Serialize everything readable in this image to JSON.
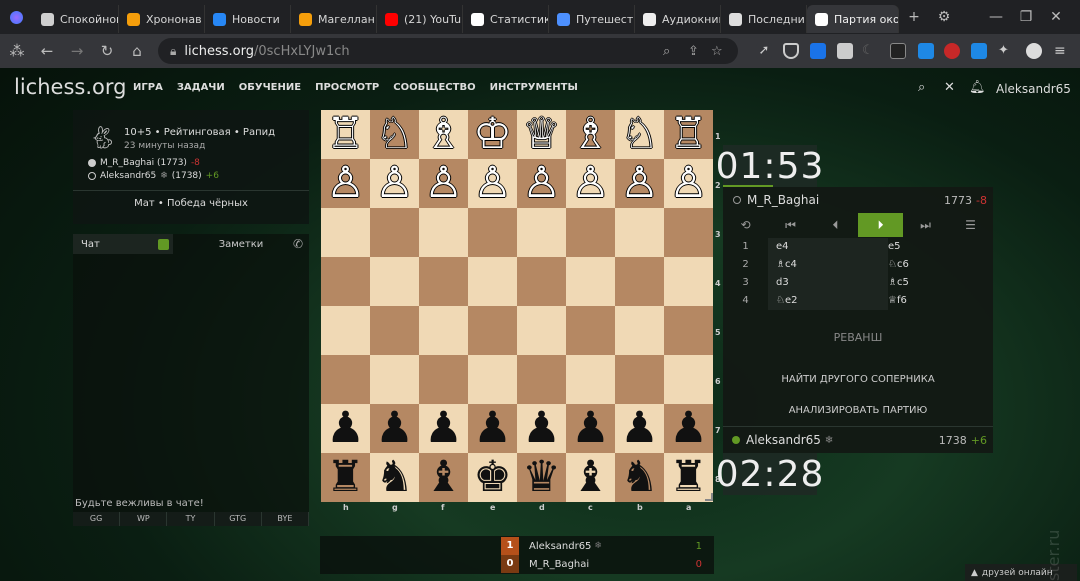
{
  "browser": {
    "tabs": [
      {
        "title": "Спокойнок",
        "color": "#cfcfcf"
      },
      {
        "title": "Хрононав",
        "color": "#f59e0b"
      },
      {
        "title": "Новости",
        "color": "#2787f5"
      },
      {
        "title": "Магеллан",
        "color": "#f59e0b"
      },
      {
        "title": "(21) YouTub",
        "color": "#ff0000"
      },
      {
        "title": "Статистик",
        "color": "#ffffff"
      },
      {
        "title": "Путешеств",
        "color": "#4d90fe"
      },
      {
        "title": "Аудиокниг",
        "color": "#eeeeee"
      },
      {
        "title": "Последни",
        "color": "#dddddd"
      },
      {
        "title": "Партия око",
        "color": "#ffffff"
      }
    ],
    "new_tab": "+",
    "url_host": "lichess.org",
    "url_path": "/0scHxLYJw1ch"
  },
  "site": {
    "logo": "lichess.org",
    "menu": [
      "ИГРА",
      "ЗАДАЧИ",
      "ОБУЧЕНИЕ",
      "ПРОСМОТР",
      "СООБЩЕСТВО",
      "ИНСТРУМЕНТЫ"
    ],
    "username": "Aleksandr65"
  },
  "game_info": {
    "mode": "10+5 • Рейтинговая • Рапид",
    "time_ago": "23 минуты назад",
    "player1": "M_R_Baghai (1773)",
    "player1_diff": "-8",
    "player2": "Aleksandr65",
    "player2_rating": "(1738)",
    "player2_diff": "+6",
    "result": "Мат • Победа чёрных"
  },
  "chat": {
    "tab_chat": "Чат",
    "tab_notes": "Заметки",
    "rule": "Будьте вежливы в чате!",
    "quick": [
      "GG",
      "WP",
      "TY",
      "GTG",
      "BYE"
    ]
  },
  "board": {
    "rows": [
      [
        "♖",
        "♘",
        "♗",
        "♔",
        "♕",
        "♗",
        "♘",
        "♖"
      ],
      [
        "♙",
        "♙",
        "♙",
        "♙",
        "♙",
        "♙",
        "♙",
        "♙"
      ],
      [
        "",
        "",
        "",
        "",
        "",
        "",
        "",
        ""
      ],
      [
        "",
        "",
        "",
        "",
        "",
        "",
        "",
        ""
      ],
      [
        "",
        "",
        "",
        "",
        "",
        "",
        "",
        ""
      ],
      [
        "",
        "",
        "",
        "",
        "",
        "",
        "",
        ""
      ],
      [
        "♟",
        "♟",
        "♟",
        "♟",
        "♟",
        "♟",
        "♟",
        "♟"
      ],
      [
        "♜",
        "♞",
        "♝",
        "♚",
        "♛",
        "♝",
        "♞",
        "♜"
      ]
    ],
    "rank_labels": [
      "1",
      "2",
      "3",
      "4",
      "5",
      "6",
      "7",
      "8"
    ],
    "file_labels": [
      "h",
      "g",
      "f",
      "e",
      "d",
      "c",
      "b",
      "a"
    ]
  },
  "clocks": {
    "top": "01:53",
    "bottom": "02:28"
  },
  "right_panel": {
    "opponent_name": "M_R_Baghai",
    "opponent_rating": "1773",
    "opponent_diff": "-8",
    "moves": [
      {
        "n": "1",
        "w": "e4",
        "b": "e5"
      },
      {
        "n": "2",
        "w": "♗c4",
        "b": "♘c6"
      },
      {
        "n": "3",
        "w": "d3",
        "b": "♗c5"
      },
      {
        "n": "4",
        "w": "♘e2",
        "b": "♕f6"
      }
    ],
    "rematch": "РЕВАНШ",
    "new_opponent": "НАЙТИ ДРУГОГО СОПЕРНИКА",
    "analyze": "АНАЛИЗИРОВАТЬ ПАРТИЮ",
    "me_name": "Aleksandr65",
    "me_rating": "1738",
    "me_diff": "+6"
  },
  "scoreboard": {
    "rows": [
      {
        "score": "1",
        "name": "Aleksandr65",
        "right": "1"
      },
      {
        "score": "0",
        "name": "M_R_Baghai",
        "right": "0"
      }
    ]
  },
  "friends_online": "друзей онлайн",
  "watermark": "ster.ru"
}
